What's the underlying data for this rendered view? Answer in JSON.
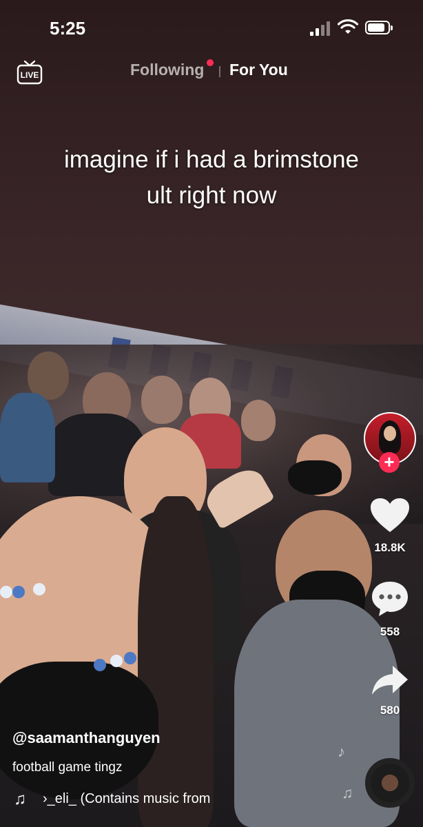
{
  "status_bar": {
    "time": "5:25",
    "battery_level": 0.85
  },
  "top_nav": {
    "live_label": "LIVE",
    "tabs": [
      {
        "label": "Following",
        "has_notification": true
      },
      {
        "label": "For You",
        "active": true
      }
    ]
  },
  "video": {
    "caption_lines": [
      "imagine if i had a brimstone",
      "ult right now"
    ]
  },
  "actions": {
    "like_count": "18.8K",
    "comment_count": "558",
    "share_count": "580",
    "follow_icon": "plus-icon"
  },
  "post": {
    "username": "@saamanthanguyen",
    "description": "football game tingz",
    "music": "›_eli_ (Contains music from"
  },
  "colors": {
    "accent": "#fe2c55",
    "notification": "#fe2c55",
    "text": "#ffffff"
  },
  "icons": [
    "live-icon",
    "heart-icon",
    "comment-icon",
    "share-icon",
    "music-note-icon",
    "music-disc-icon"
  ]
}
